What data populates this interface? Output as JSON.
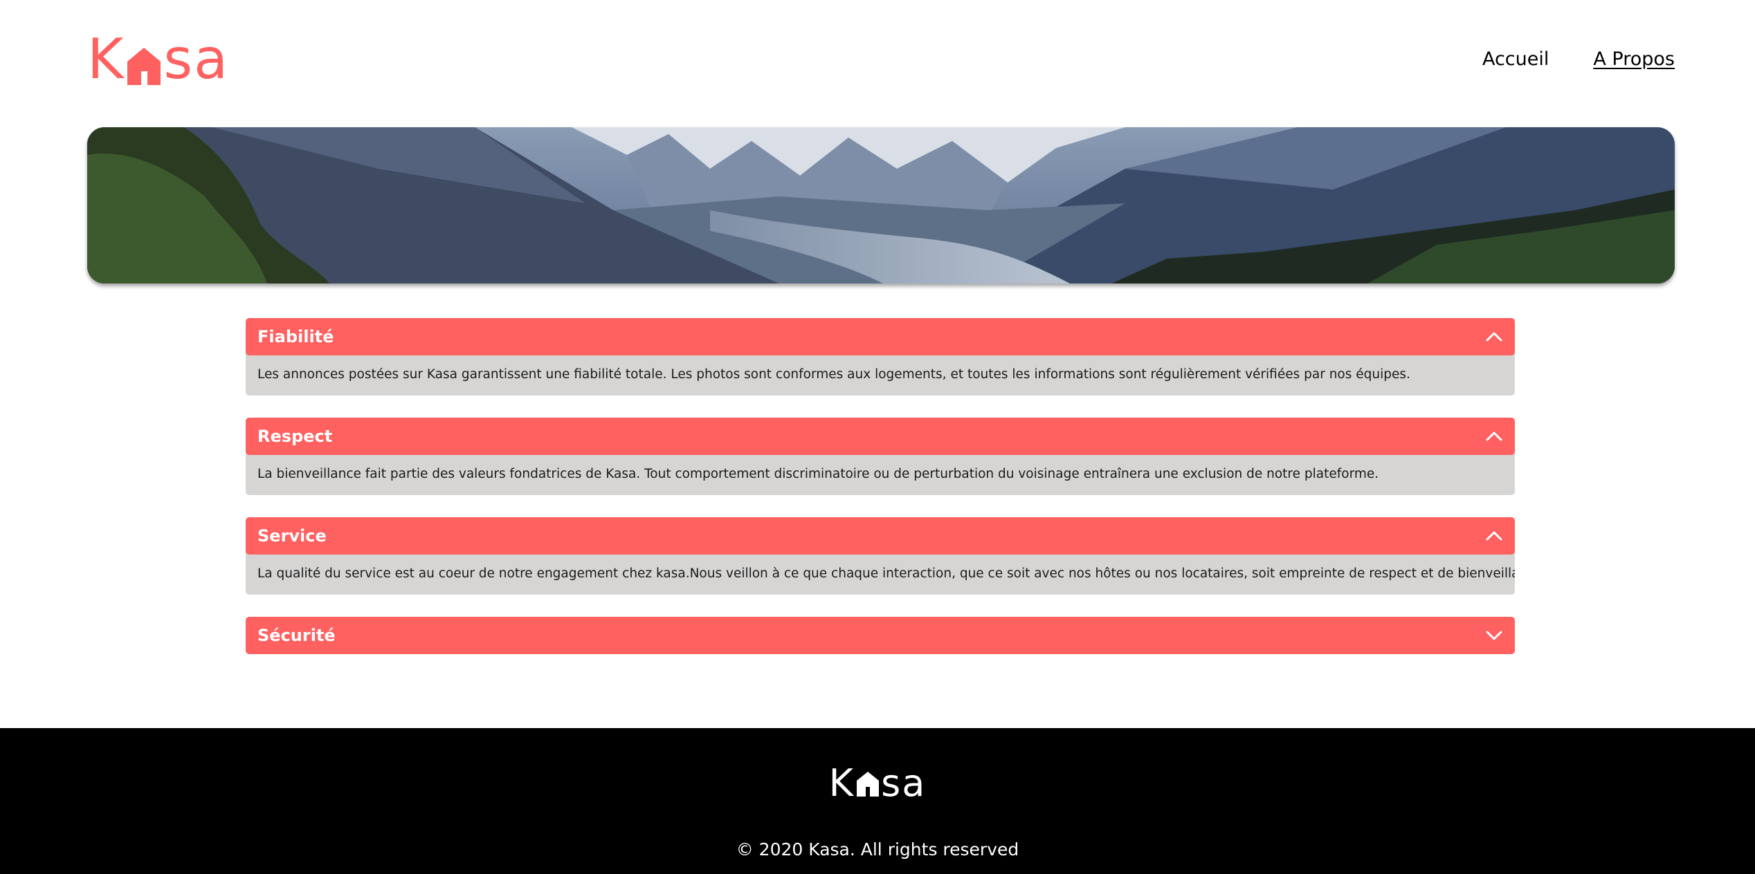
{
  "colors": {
    "accent": "#ff6060",
    "panel": "#d6d5d4",
    "footer_bg": "#000000"
  },
  "header": {
    "logo": {
      "part1": "K",
      "icon": "house-icon",
      "part2": "sa"
    },
    "nav": [
      {
        "label": "Accueil",
        "active": false
      },
      {
        "label": "A Propos",
        "active": true
      }
    ]
  },
  "banner": {
    "image": "mountain-valley-landscape"
  },
  "accordion": [
    {
      "title": "Fiabilité",
      "expanded": true,
      "content": "Les annonces postées sur Kasa garantissent une fiabilité totale. Les photos sont conformes aux logements, et toutes les informations sont régulièrement vérifiées par nos équipes."
    },
    {
      "title": "Respect",
      "expanded": true,
      "content": "La bienveillance fait partie des valeurs fondatrices de Kasa. Tout comportement discriminatoire ou de perturbation du voisinage entraînera une exclusion de notre plateforme."
    },
    {
      "title": "Service",
      "expanded": true,
      "content": "La qualité du service est au coeur de notre engagement chez kasa.Nous veillon à ce que chaque interaction, que ce soit avec nos hôtes ou nos locataires, soit empreinte de respect et de bienveillance."
    },
    {
      "title": "Sécurité",
      "expanded": false,
      "content": ""
    }
  ],
  "footer": {
    "logo": {
      "part1": "K",
      "icon": "house-icon",
      "part2": "sa"
    },
    "copyright": "© 2020 Kasa. All rights reserved"
  }
}
